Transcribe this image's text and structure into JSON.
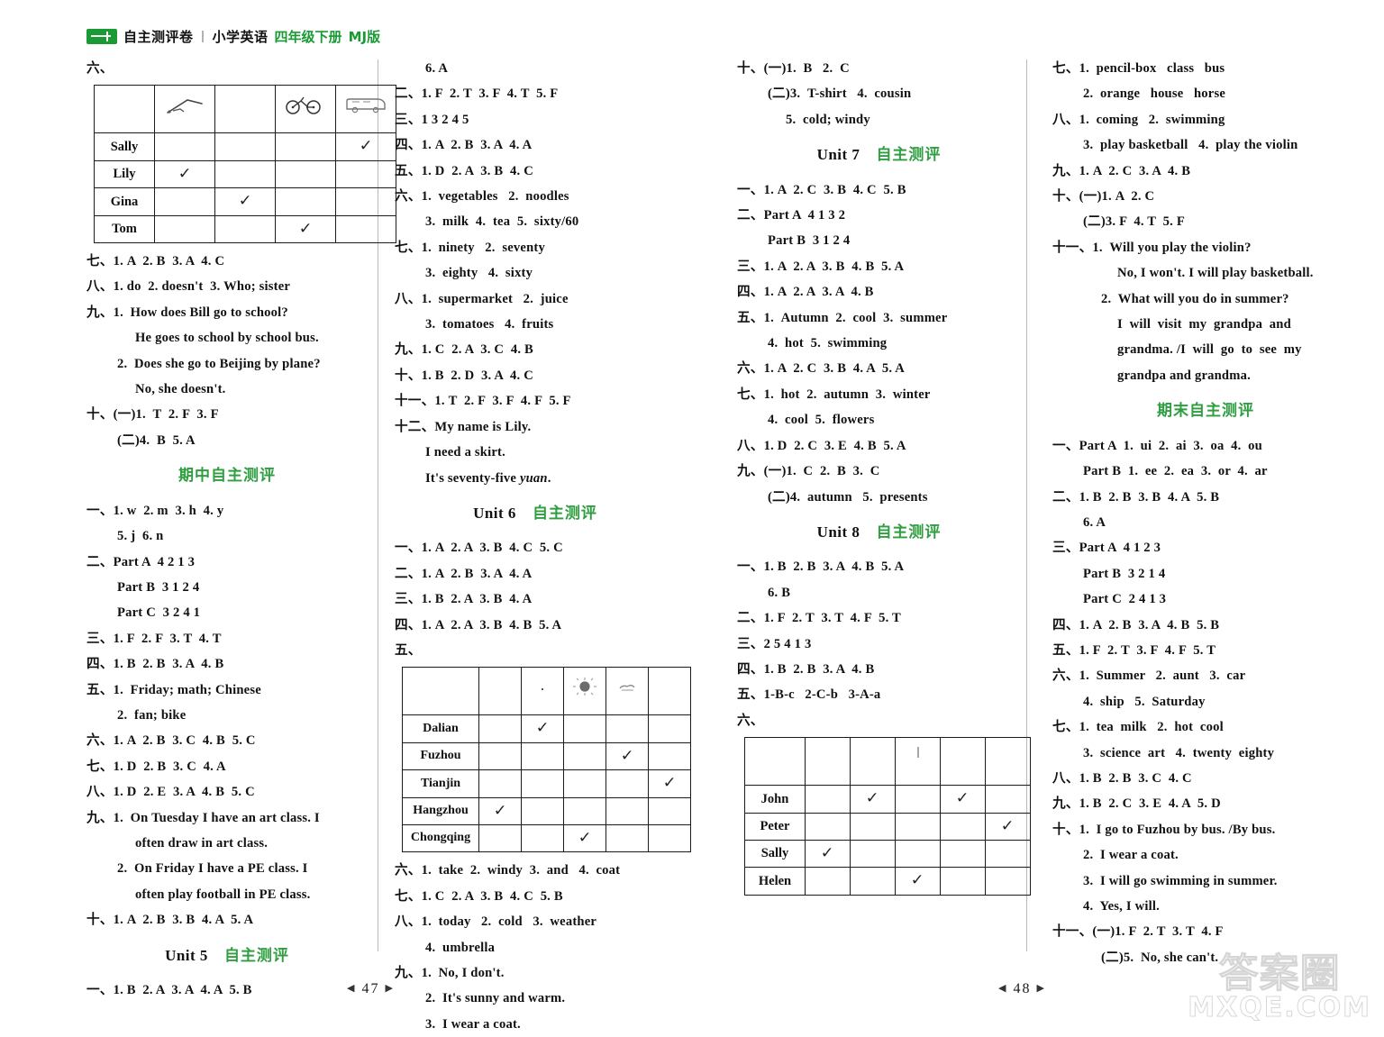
{
  "header": {
    "logo": "green-book-badge",
    "title_cn": "自主测评卷",
    "separator": "|",
    "subject_cn": "小学英语",
    "grade_cn": "四年级下册",
    "edition": "MJ版"
  },
  "footer": {
    "page_left": "47",
    "page_right": "48",
    "watermark_cn": "答案圈",
    "watermark_url": "MXQE.COM"
  },
  "columns": {
    "col1": {
      "blocks": [
        {
          "type": "label",
          "text": "六、"
        },
        {
          "type": "table",
          "name": "transport-survey-table",
          "headers": [
            "",
            "walk-icon",
            "",
            "bicycle-icon",
            "bus-icon"
          ],
          "rows": [
            {
              "name": "Sally",
              "marks": [
                false,
                false,
                false,
                true
              ]
            },
            {
              "name": "Lily",
              "marks": [
                true,
                false,
                false,
                false
              ]
            },
            {
              "name": "Gina",
              "marks": [
                false,
                true,
                false,
                false
              ]
            },
            {
              "name": "Tom",
              "marks": [
                false,
                false,
                true,
                false
              ]
            }
          ],
          "tick": "✓"
        },
        {
          "type": "line",
          "text": "七、1. A  2. B  3. A  4. C"
        },
        {
          "type": "line",
          "text": "八、1. do  2. doesn't  3. Who; sister"
        },
        {
          "type": "line",
          "text": "九、1.  How does Bill go to school?"
        },
        {
          "type": "line",
          "indent": 2,
          "text": "He goes to school by school bus."
        },
        {
          "type": "line",
          "indent": 1,
          "text": "2.  Does she go to Beijing by plane?"
        },
        {
          "type": "line",
          "indent": 2,
          "text": "No, she doesn't."
        },
        {
          "type": "line",
          "text": "十、(一)1.  T  2. F  3. F"
        },
        {
          "type": "line",
          "indent": 1,
          "text": "(二)4.  B  5. A"
        },
        {
          "type": "heading",
          "en": "",
          "cn": "期中自主测评"
        },
        {
          "type": "line",
          "text": "一、1. w  2. m  3. h  4. y"
        },
        {
          "type": "line",
          "indent": 1,
          "text": "5. j  6. n"
        },
        {
          "type": "line",
          "text": "二、Part A  4 2 1 3"
        },
        {
          "type": "line",
          "indent": 1,
          "text": "Part B  3 1 2 4"
        },
        {
          "type": "line",
          "indent": 1,
          "text": "Part C  3 2 4 1"
        },
        {
          "type": "line",
          "text": "三、1. F  2. F  3. T  4. T"
        },
        {
          "type": "line",
          "text": "四、1. B  2. B  3. A  4. B"
        },
        {
          "type": "line",
          "text": "五、1.  Friday; math; Chinese"
        },
        {
          "type": "line",
          "indent": 1,
          "text": "2.  fan; bike"
        },
        {
          "type": "line",
          "text": "六、1. A  2. B  3. C  4. B  5. C"
        },
        {
          "type": "line",
          "text": "七、1. D  2. B  3. C  4. A"
        },
        {
          "type": "line",
          "text": "八、1. D  2. E  3. A  4. B  5. C"
        },
        {
          "type": "line",
          "text": "九、1.  On Tuesday I have an art class. I"
        },
        {
          "type": "line",
          "indent": 2,
          "text": "often draw in art class."
        },
        {
          "type": "line",
          "indent": 1,
          "text": "2.  On Friday I have a PE class. I"
        },
        {
          "type": "line",
          "indent": 2,
          "text": "often play football in PE class."
        },
        {
          "type": "line",
          "text": "十、1. A  2. B  3. B  4. A  5. A"
        },
        {
          "type": "heading",
          "en": "Unit 5",
          "cn": "自主测评"
        },
        {
          "type": "line",
          "text": "一、1. B  2. A  3. A  4. A  5. B"
        }
      ]
    },
    "col2": {
      "blocks": [
        {
          "type": "line",
          "indent": 1,
          "text": "6. A"
        },
        {
          "type": "line",
          "text": "二、1. F  2. T  3. F  4. T  5. F"
        },
        {
          "type": "line",
          "text": "三、1 3 2 4 5"
        },
        {
          "type": "line",
          "text": "四、1. A  2. B  3. A  4. A"
        },
        {
          "type": "line",
          "text": "五、1. D  2. A  3. B  4. C"
        },
        {
          "type": "line",
          "text": "六、1.  vegetables   2.  noodles"
        },
        {
          "type": "line",
          "indent": 1,
          "text": "3.  milk  4.  tea  5.  sixty/60"
        },
        {
          "type": "line",
          "text": "七、1.  ninety   2.  seventy"
        },
        {
          "type": "line",
          "indent": 1,
          "text": "3.  eighty   4.  sixty"
        },
        {
          "type": "line",
          "text": "八、1.  supermarket   2.  juice"
        },
        {
          "type": "line",
          "indent": 1,
          "text": "3.  tomatoes   4.  fruits"
        },
        {
          "type": "line",
          "text": "九、1. C  2. A  3. C  4. B"
        },
        {
          "type": "line",
          "text": "十、1. B  2. D  3. A  4. C"
        },
        {
          "type": "line",
          "text": "十一、1. T  2. F  3. F  4. F  5. F"
        },
        {
          "type": "line",
          "text": "十二、My name is Lily."
        },
        {
          "type": "line",
          "indent": 1,
          "text": "I need a skirt."
        },
        {
          "type": "line",
          "indent": 1,
          "text": "It's seventy-five yuan."
        },
        {
          "type": "heading",
          "en": "Unit 6",
          "cn": "自主测评"
        },
        {
          "type": "line",
          "text": "一、1. A  2. A  3. B  4. C  5. C"
        },
        {
          "type": "line",
          "text": "二、1. A  2. B  3. A  4. A"
        },
        {
          "type": "line",
          "text": "三、1. B  2. A  3. B  4. A"
        },
        {
          "type": "line",
          "text": "四、1. A  2. A  3. B  4. B  5. A"
        },
        {
          "type": "label",
          "text": "五、"
        },
        {
          "type": "table",
          "name": "weather-city-table",
          "headers": [
            "",
            "",
            "rain-icon",
            "sun-icon",
            "cloud-icon",
            ""
          ],
          "rows": [
            {
              "name": "Dalian",
              "marks": [
                false,
                true,
                false,
                false,
                false
              ]
            },
            {
              "name": "Fuzhou",
              "marks": [
                false,
                false,
                false,
                true,
                false
              ]
            },
            {
              "name": "Tianjin",
              "marks": [
                false,
                false,
                false,
                false,
                true
              ]
            },
            {
              "name": "Hangzhou",
              "marks": [
                true,
                false,
                false,
                false,
                false
              ]
            },
            {
              "name": "Chongqing",
              "marks": [
                false,
                false,
                true,
                false,
                false
              ]
            }
          ],
          "tick": "✓"
        },
        {
          "type": "line",
          "text": "六、1.  take  2.  windy  3.  and   4.  coat"
        },
        {
          "type": "line",
          "text": "七、1. C  2. A  3. B  4. C  5. B"
        },
        {
          "type": "line",
          "text": "八、1.  today   2.  cold   3.  weather"
        },
        {
          "type": "line",
          "indent": 1,
          "text": "4.  umbrella"
        },
        {
          "type": "line",
          "text": "九、1.  No, I don't."
        },
        {
          "type": "line",
          "indent": 1,
          "text": "2.  It's sunny and warm."
        },
        {
          "type": "line",
          "indent": 1,
          "text": "3.  I wear a coat."
        }
      ]
    },
    "col3": {
      "blocks": [
        {
          "type": "line",
          "text": "十、(一)1.  B   2.  C"
        },
        {
          "type": "line",
          "indent": 1,
          "text": "(二)3.  T-shirt   4.  cousin"
        },
        {
          "type": "line",
          "indent": 2,
          "text": "5.  cold; windy"
        },
        {
          "type": "heading",
          "en": "Unit 7",
          "cn": "自主测评"
        },
        {
          "type": "line",
          "text": "一、1. A  2. C  3. B  4. C  5. B"
        },
        {
          "type": "line",
          "text": "二、Part A  4 1 3 2"
        },
        {
          "type": "line",
          "indent": 1,
          "text": "Part B  3 1 2 4"
        },
        {
          "type": "line",
          "text": "三、1. A  2. A  3. B  4. B  5. A"
        },
        {
          "type": "line",
          "text": "四、1. A  2. A  3. A  4. B"
        },
        {
          "type": "line",
          "text": "五、1.  Autumn  2.  cool  3.  summer"
        },
        {
          "type": "line",
          "indent": 1,
          "text": "4.  hot  5.  swimming"
        },
        {
          "type": "line",
          "text": "六、1. A  2. C  3. B  4. A  5. A"
        },
        {
          "type": "line",
          "text": "七、1.  hot  2.  autumn  3.  winter"
        },
        {
          "type": "line",
          "indent": 1,
          "text": "4.  cool  5.  flowers"
        },
        {
          "type": "line",
          "text": "八、1. D  2. C  3. E  4. B  5. A"
        },
        {
          "type": "line",
          "text": "九、(一)1.  C  2.  B  3.  C"
        },
        {
          "type": "line",
          "indent": 1,
          "text": "(二)4.  autumn   5.  presents"
        },
        {
          "type": "heading",
          "en": "Unit 8",
          "cn": "自主测评"
        },
        {
          "type": "line",
          "text": "一、1. B  2. B  3. A  4. B  5. A"
        },
        {
          "type": "line",
          "indent": 1,
          "text": "6. B"
        },
        {
          "type": "line",
          "text": "二、1. F  2. T  3. T  4. F  5. T"
        },
        {
          "type": "line",
          "text": "三、2 5 4 1 3"
        },
        {
          "type": "line",
          "text": "四、1. B  2. B  3. A  4. B"
        },
        {
          "type": "line",
          "text": "五、1-B-c   2-C-b   3-A-a"
        },
        {
          "type": "label",
          "text": "六、"
        },
        {
          "type": "table",
          "name": "activity-people-table",
          "headers": [
            "",
            "",
            "",
            "mark-icon",
            "",
            ""
          ],
          "rows": [
            {
              "name": "John",
              "marks": [
                false,
                true,
                false,
                true,
                false
              ]
            },
            {
              "name": "Peter",
              "marks": [
                false,
                false,
                false,
                false,
                true
              ]
            },
            {
              "name": "Sally",
              "marks": [
                true,
                false,
                false,
                false,
                false
              ]
            },
            {
              "name": "Helen",
              "marks": [
                false,
                false,
                true,
                false,
                false
              ]
            }
          ],
          "tick": "✓"
        }
      ]
    },
    "col4": {
      "blocks": [
        {
          "type": "line",
          "text": "七、1.  pencil-box   class   bus"
        },
        {
          "type": "line",
          "indent": 1,
          "text": "2.  orange   house   horse"
        },
        {
          "type": "line",
          "text": "八、1.  coming   2.  swimming"
        },
        {
          "type": "line",
          "indent": 1,
          "text": "3.  play basketball   4.  play the violin"
        },
        {
          "type": "line",
          "text": "九、1. A  2. C  3. A  4. B"
        },
        {
          "type": "line",
          "text": "十、(一)1. A  2. C"
        },
        {
          "type": "line",
          "indent": 1,
          "text": "(二)3. F  4. T  5. F"
        },
        {
          "type": "line",
          "text": "十一、1.  Will you play the violin?"
        },
        {
          "type": "line",
          "indent": 3,
          "text": "No, I won't. I will play basketball."
        },
        {
          "type": "line",
          "indent": 2,
          "text": "2.  What will you do in summer?"
        },
        {
          "type": "line",
          "indent": 3,
          "text": "I  will  visit  my  grandpa  and"
        },
        {
          "type": "line",
          "indent": 3,
          "text": "grandma. /I  will  go  to  see  my"
        },
        {
          "type": "line",
          "indent": 3,
          "text": "grandpa and grandma."
        },
        {
          "type": "heading",
          "en": "",
          "cn": "期末自主测评"
        },
        {
          "type": "line",
          "text": "一、Part A  1.  ui  2.  ai  3.  oa  4.  ou"
        },
        {
          "type": "line",
          "indent": 1,
          "text": "Part B  1.  ee  2.  ea  3.  or  4.  ar"
        },
        {
          "type": "line",
          "text": "二、1. B  2. B  3. B  4. A  5. B"
        },
        {
          "type": "line",
          "indent": 1,
          "text": "6. A"
        },
        {
          "type": "line",
          "text": "三、Part A  4 1 2 3"
        },
        {
          "type": "line",
          "indent": 1,
          "text": "Part B  3 2 1 4"
        },
        {
          "type": "line",
          "indent": 1,
          "text": "Part C  2 4 1 3"
        },
        {
          "type": "line",
          "text": "四、1. A  2. B  3. A  4. B  5. B"
        },
        {
          "type": "line",
          "text": "五、1. F  2. T  3. F  4. F  5. T"
        },
        {
          "type": "line",
          "text": "六、1.  Summer   2.  aunt   3.  car"
        },
        {
          "type": "line",
          "indent": 1,
          "text": "4.  ship   5.  Saturday"
        },
        {
          "type": "line",
          "text": "七、1.  tea  milk   2.  hot  cool"
        },
        {
          "type": "line",
          "indent": 1,
          "text": "3.  science  art   4.  twenty  eighty"
        },
        {
          "type": "line",
          "text": "八、1. B  2. B  3. C  4. C"
        },
        {
          "type": "line",
          "text": "九、1. B  2. C  3. E  4. A  5. D"
        },
        {
          "type": "line",
          "text": "十、1.  I go to Fuzhou by bus. /By bus."
        },
        {
          "type": "line",
          "indent": 1,
          "text": "2.  I wear a coat."
        },
        {
          "type": "line",
          "indent": 1,
          "text": "3.  I will go swimming in summer."
        },
        {
          "type": "line",
          "indent": 1,
          "text": "4.  Yes, I will."
        },
        {
          "type": "line",
          "text": "十一、(一)1. F  2. T  3. T  4. F"
        },
        {
          "type": "line",
          "indent": 2,
          "text": "(二)5.  No, she can't."
        }
      ]
    }
  }
}
